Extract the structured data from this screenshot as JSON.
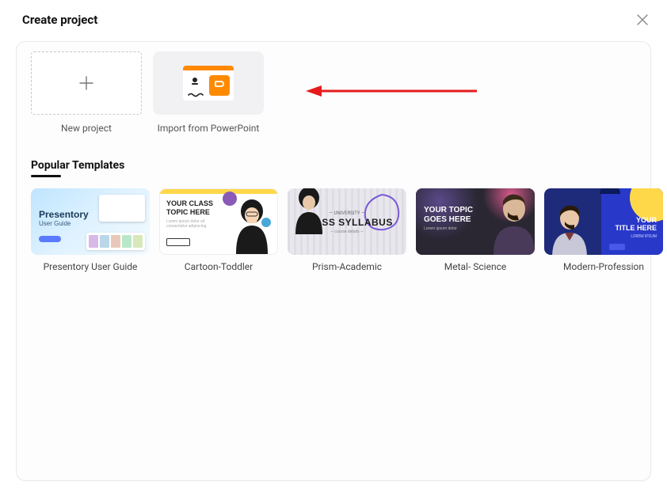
{
  "dialog": {
    "title": "Create project"
  },
  "create": {
    "new_label": "New project",
    "import_label": "Import from PowerPoint"
  },
  "section": {
    "title": "Popular Templates"
  },
  "templates": [
    {
      "label": "Presentory User Guide",
      "thumb_title": "Presentory",
      "thumb_sub": "User Guide"
    },
    {
      "label": "Cartoon-Toddler",
      "thumb_title": "YOUR CLASS",
      "thumb_sub": "TOPIC HERE"
    },
    {
      "label": "Prism-Academic",
      "thumb_title": "CLASS SYLLABUS"
    },
    {
      "label": "Metal- Science",
      "thumb_title": "YOUR TOPIC",
      "thumb_sub": "GOES HERE"
    },
    {
      "label": "Modern-Profession",
      "thumb_title": "YOUR",
      "thumb_sub": "TITLE HERE"
    }
  ]
}
